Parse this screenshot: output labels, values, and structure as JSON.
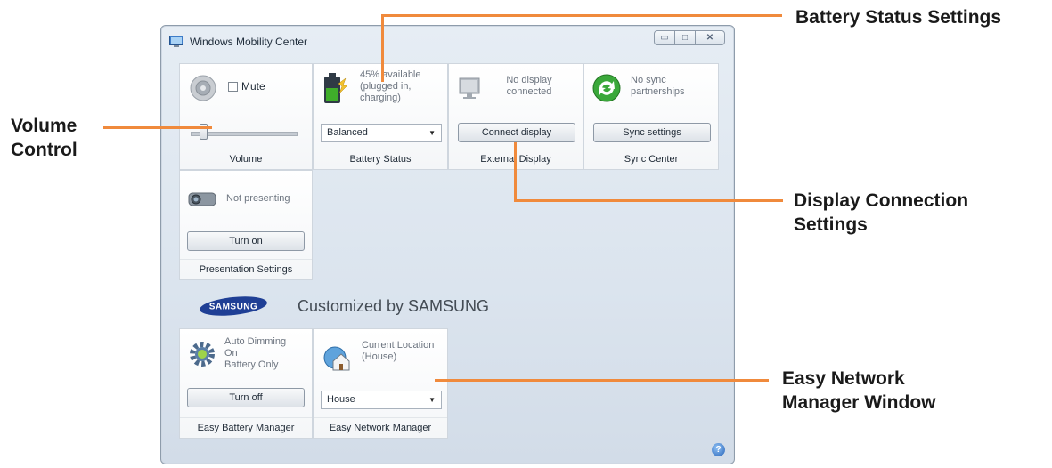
{
  "window": {
    "title": "Windows Mobility Center",
    "controls": {
      "minimize": "▭",
      "maximize": "□",
      "close": "✕"
    }
  },
  "tiles": {
    "volume": {
      "mute_label": "Mute",
      "mute_checked": false,
      "volume_level": 0.1,
      "caption": "Volume"
    },
    "battery": {
      "status_line1": "45% available",
      "status_line2": "(plugged in,",
      "status_line3": "charging)",
      "plan": "Balanced",
      "caption": "Battery Status",
      "level": 0.45
    },
    "external_display": {
      "status_line1": "No display",
      "status_line2": "connected",
      "button": "Connect display",
      "caption": "External Display"
    },
    "sync": {
      "status_line1": "No sync",
      "status_line2": "partnerships",
      "button": "Sync settings",
      "caption": "Sync Center"
    },
    "presentation": {
      "status": "Not presenting",
      "button": "Turn on",
      "caption": "Presentation Settings"
    },
    "easy_battery": {
      "status_line1": "Auto Dimming",
      "status_line2": "On",
      "status_line3": "Battery Only",
      "button": "Turn off",
      "caption": "Easy Battery Manager"
    },
    "easy_network": {
      "status_line1": "Current Location",
      "status_line2": "(House)",
      "location": "House",
      "caption": "Easy Network Manager"
    }
  },
  "branding": {
    "logo": "SAMSUNG",
    "customized_text": "Customized by SAMSUNG"
  },
  "annotations": {
    "battery_status_settings": "Battery Status Settings",
    "volume_line1": "Volume",
    "volume_line2": "Control",
    "display_line1": "Display Connection",
    "display_line2": "Settings",
    "network_line1": "Easy Network",
    "network_line2": "Manager Window"
  },
  "colors": {
    "annotation_line": "#f08a3c",
    "sync_green": "#3aa83a",
    "battery_green": "#3fae2a"
  }
}
